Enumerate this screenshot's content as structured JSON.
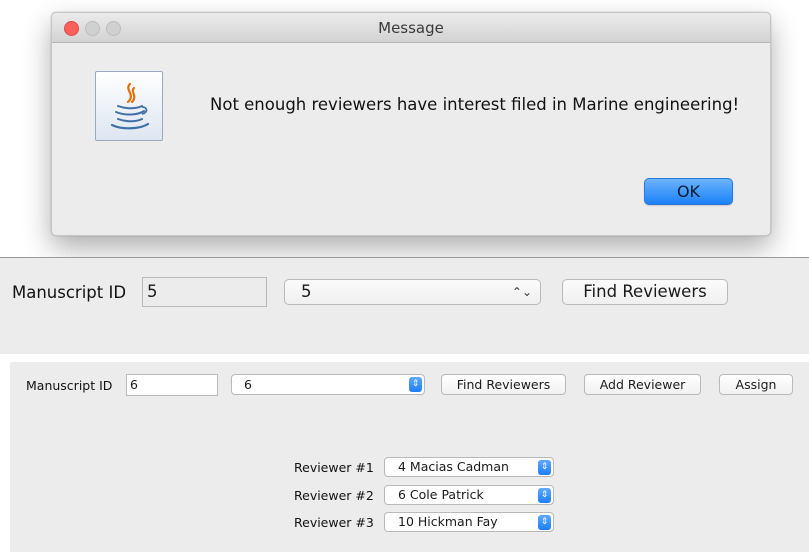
{
  "dialog": {
    "title": "Message",
    "message": "Not enough reviewers have interest filed in Marine engineering!",
    "ok_label": "OK",
    "icon": "java-icon"
  },
  "panel1": {
    "manuscript_label": "Manuscript ID",
    "manuscript_value": "5",
    "combo_value": "5",
    "find_label": "Find Reviewers"
  },
  "panel2": {
    "manuscript_label": "Manuscript ID",
    "manuscript_value": "6",
    "combo_value": "6",
    "find_label": "Find Reviewers",
    "add_label": "Add Reviewer",
    "assign_label": "Assign",
    "reviewers": [
      {
        "label": "Reviewer #1",
        "value": "4 Macias Cadman"
      },
      {
        "label": "Reviewer #2",
        "value": "6 Cole Patrick"
      },
      {
        "label": "Reviewer #3",
        "value": "10 Hickman Fay"
      }
    ]
  },
  "colors": {
    "accent": "#1b80f7",
    "close": "#fc605b",
    "panel_bg": "#ececec"
  }
}
